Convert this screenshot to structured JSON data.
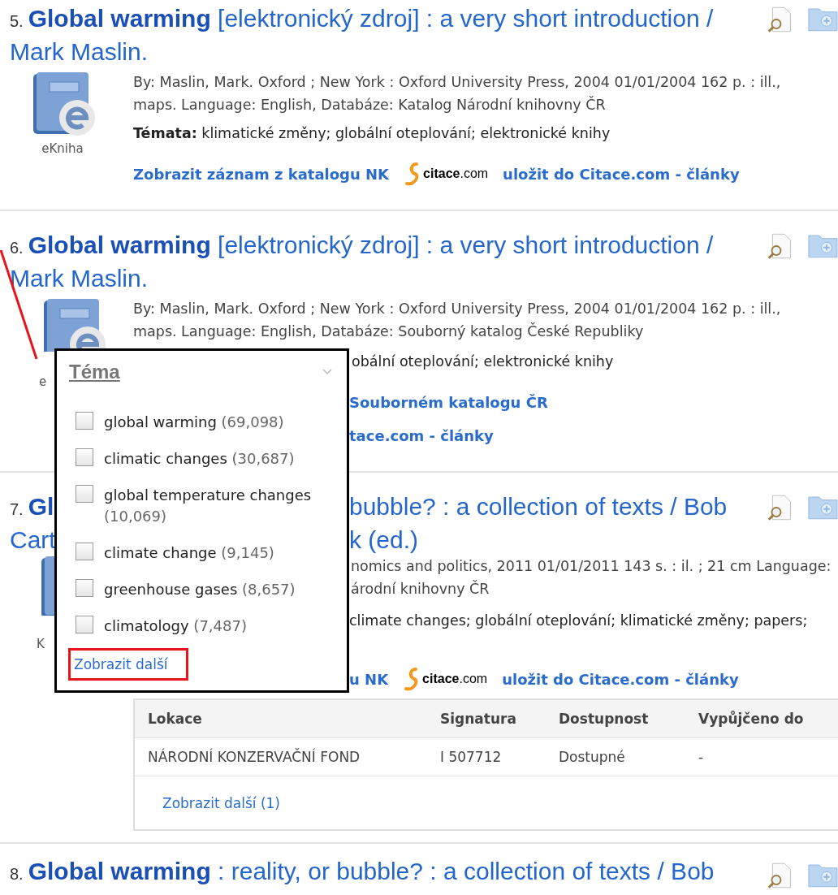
{
  "records": [
    {
      "kind": "full",
      "number": "5.",
      "title": "**Global warming** [elektronický zdroj] : a very short introduction / Mark Maslin.",
      "format": "eKniha",
      "details": "By: Maslin, Mark. Oxford ; New York : Oxford University Press, 2004 01/01/2004 162 p. : ill., maps. Language: English, Databáze: Katalog Národní knihovny ČR",
      "topics": "**Témata:** klimatické změny; globální oteplování; elektronické knihy",
      "links": {
        "catalog": "Zobrazit záznam z katalogu NK",
        "logo": "**citace**.com",
        "save": "uložit do Citace.com - články"
      }
    },
    {
      "kind": "partial",
      "number": "6.",
      "title": "**Global warming** [elektronický zdroj] : a very short introduction / Mark Maslin.",
      "format": "e",
      "details": "By: Maslin, Mark. Oxford ; New York : Oxford University Press, 2004 01/01/2004 162 p. : ill., maps. Language: English, Databáze: Souborný katalog České Republiky",
      "topics": "obální oteplování; elektronické knihy",
      "link_lines": [
        "Souborném katalogu ČR",
        "tace.com - články"
      ]
    },
    {
      "kind": "covered",
      "number": "7.",
      "title_lines": [
        {
          "left": "**Gl**",
          "right": "bubble? : a collection of texts / Bob"
        },
        {
          "left": "Cart",
          "right": "k (ed.)"
        }
      ],
      "format": "K",
      "details_lines": [
        "nomics and politics, 2011 01/01/2011 143 s. : il. ; 21 cm Language:",
        "árodní knihovny ČR"
      ],
      "topics": "climate changes; globální oteplování; klimatické změny; papers;",
      "links": {
        "catalog": "u NK",
        "logo": "**citace**.com",
        "save": "uložit do Citace.com - články"
      },
      "holdings": {
        "columns": [
          "Lokace",
          "Signatura",
          "Dostupnost",
          "Vypůjčeno do"
        ],
        "rows": [
          [
            "NÁRODNÍ KONZERVAČNÍ FOND",
            "I 507712",
            "Dostupné",
            "-"
          ]
        ],
        "more": "Zobrazit další (1)"
      }
    },
    {
      "kind": "cutoff",
      "number": "8.",
      "title": "**Global warming** : reality, or bubble? : a collection of texts / Bob"
    }
  ],
  "facet_popup": {
    "title": "Téma",
    "options": [
      {
        "label": "global warming",
        "count": "(69,098)",
        "checked": false
      },
      {
        "label": "climatic changes",
        "count": "(30,687)",
        "checked": false
      },
      {
        "label": "global temperature changes",
        "count": "(10,069)",
        "checked": false
      },
      {
        "label": "climate change",
        "count": "(9,145)",
        "checked": false
      },
      {
        "label": "greenhouse gases",
        "count": "(8,657)",
        "checked": false
      },
      {
        "label": "climatology",
        "count": "(7,487)",
        "checked": false
      }
    ],
    "more": "Zobrazit další"
  }
}
